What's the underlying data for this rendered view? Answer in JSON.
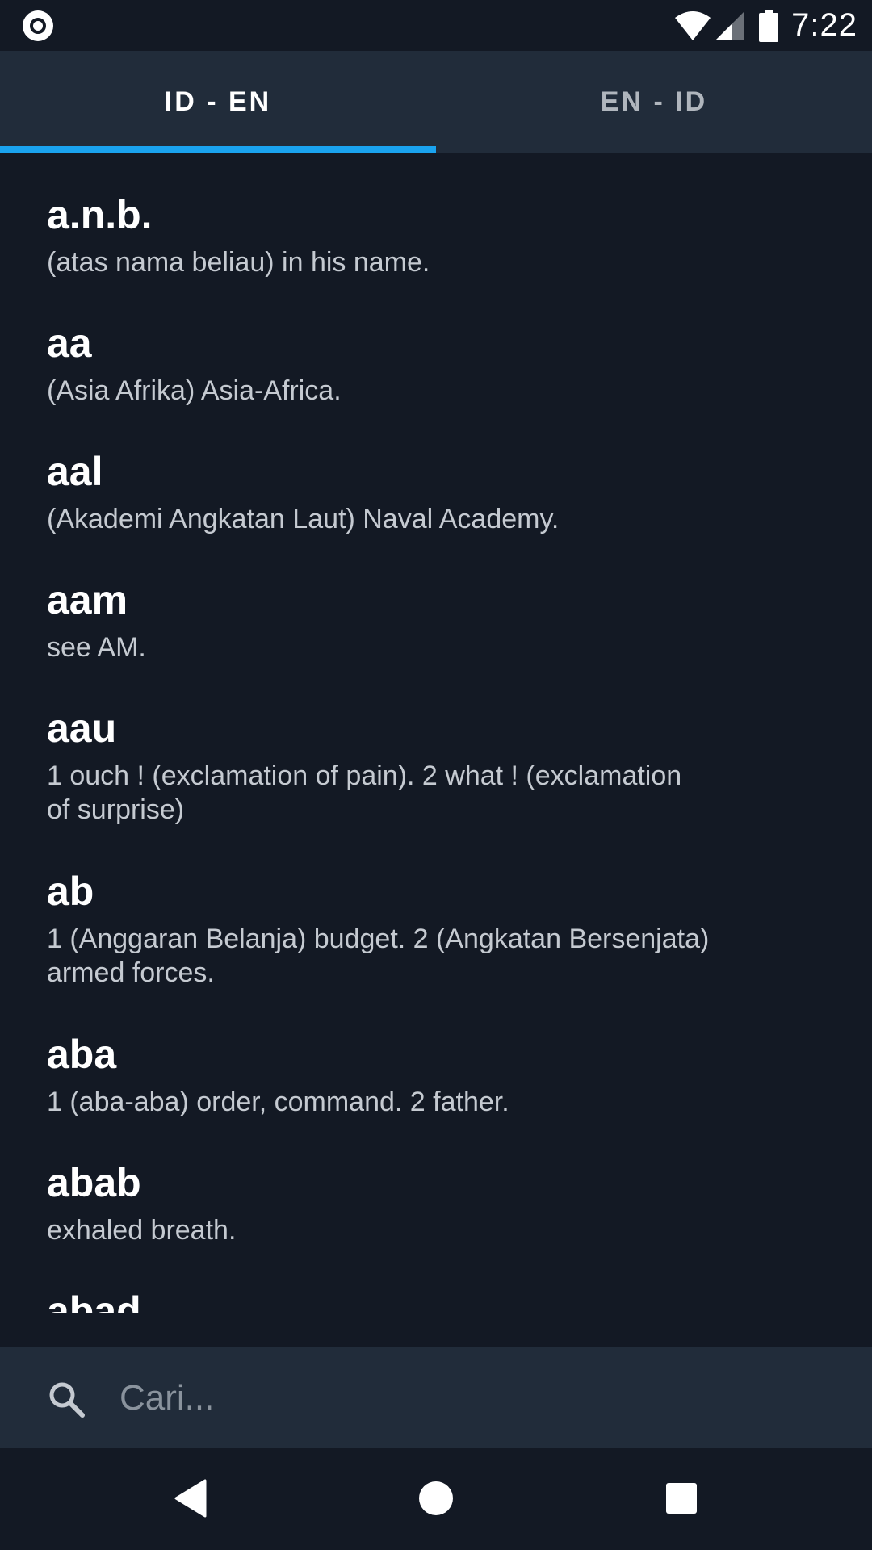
{
  "status_bar": {
    "time": "7:22",
    "left_icon": "notification-dot-icon",
    "icons": [
      "wifi-icon",
      "signal-icon",
      "battery-icon"
    ]
  },
  "tabs": [
    {
      "label": "ID - EN",
      "active": true
    },
    {
      "label": "EN - ID",
      "active": false
    }
  ],
  "entries": [
    {
      "word": "a.n.b.",
      "definition": "(atas nama beliau) in his name."
    },
    {
      "word": "aa",
      "definition": "(Asia Afrika)  Asia-Africa."
    },
    {
      "word": "aal",
      "definition": "(Akademi Angkatan Laut) Naval Academy."
    },
    {
      "word": "aam",
      "definition": "see AM."
    },
    {
      "word": "aau",
      "definition_lines": [
        "1 ouch ! (exclamation of pain). 2 what ! (exclamation",
        "of surprise)"
      ]
    },
    {
      "word": "ab",
      "definition_lines": [
        "1 (Anggaran Belanja)  budget. 2 (Angkatan Bersenjata)",
        "armed forces."
      ]
    },
    {
      "word": "aba",
      "definition": "1 (aba-aba) order, command. 2  father."
    },
    {
      "word": "abab",
      "definition": "exhaled breath."
    },
    {
      "word": "abad",
      "definition": ""
    }
  ],
  "search": {
    "placeholder": "Cari...",
    "value": "",
    "icon": "search-icon"
  },
  "nav": {
    "back": "back-icon",
    "home": "home-icon",
    "recents": "recents-icon"
  },
  "colors": {
    "background": "#131924",
    "bar": "#212c3a",
    "accent": "#1aa3ef",
    "definition_text": "#c5cad1"
  }
}
